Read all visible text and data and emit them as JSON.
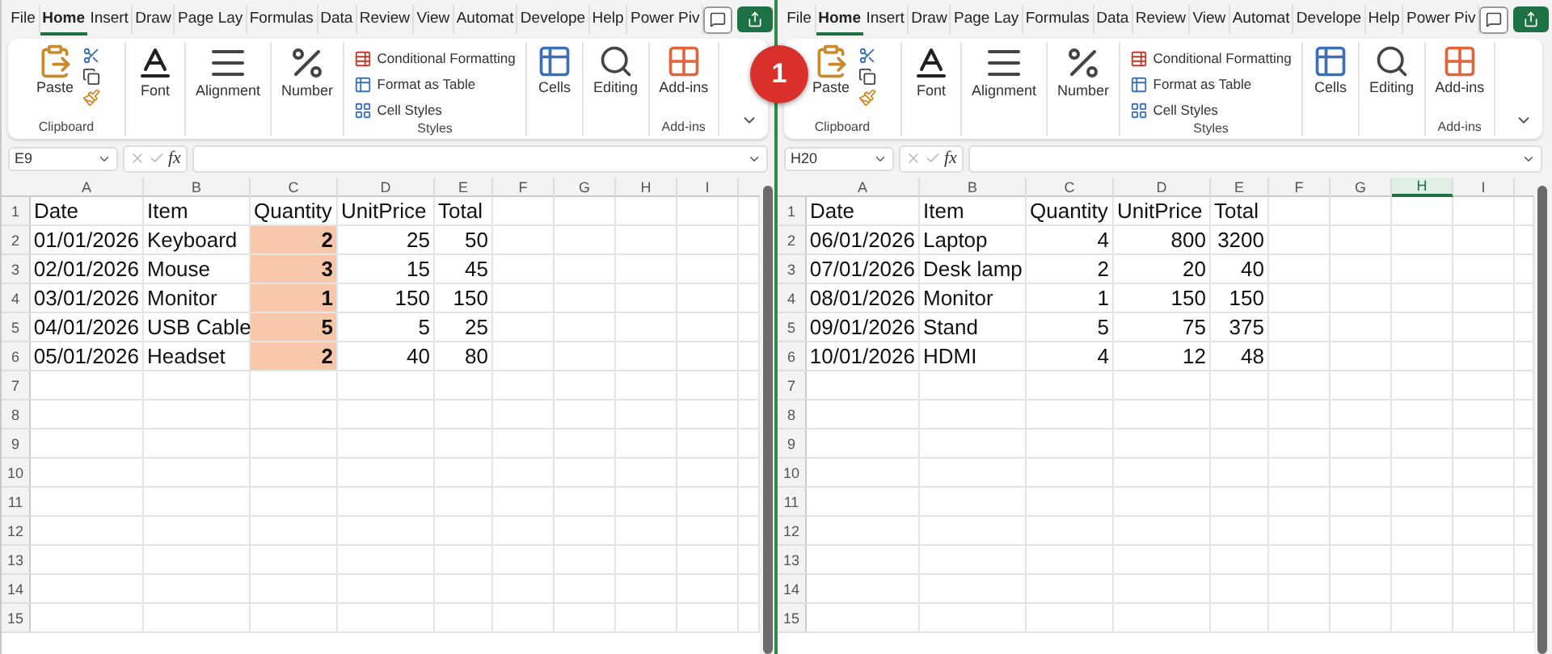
{
  "windows": [
    {
      "tabs": [
        {
          "label": "File",
          "selected": false
        },
        {
          "label": "Home",
          "selected": true
        },
        {
          "label": "Insert",
          "selected": false
        },
        {
          "label": "Draw",
          "selected": false
        },
        {
          "label": "Page Lay",
          "selected": false
        },
        {
          "label": "Formulas",
          "selected": false
        },
        {
          "label": "Data",
          "selected": false
        },
        {
          "label": "Review",
          "selected": false
        },
        {
          "label": "View",
          "selected": false
        },
        {
          "label": "Automat",
          "selected": false
        },
        {
          "label": "Develope",
          "selected": false
        },
        {
          "label": "Help",
          "selected": false
        },
        {
          "label": "Power Piv",
          "selected": false
        }
      ],
      "ribbon": [
        {
          "kind": "clipboard",
          "label": "Paste",
          "group": "Clipboard"
        },
        {
          "kind": "font",
          "label": "Font"
        },
        {
          "kind": "alignment",
          "label": "Alignment"
        },
        {
          "kind": "number",
          "label": "Number"
        },
        {
          "kind": "styles",
          "items": [
            "Conditional Formatting",
            "Format as Table",
            "Cell Styles"
          ],
          "group": "Styles"
        },
        {
          "kind": "cells",
          "label": "Cells"
        },
        {
          "kind": "editing",
          "label": "Editing"
        },
        {
          "kind": "addins",
          "label": "Add-ins",
          "group": "Add-ins"
        }
      ],
      "name_box": "E9",
      "fx": "fx",
      "columns": [
        {
          "label": "A",
          "selected": false
        },
        {
          "label": "B",
          "selected": false
        },
        {
          "label": "C",
          "selected": false
        },
        {
          "label": "D",
          "selected": false
        },
        {
          "label": "E",
          "selected": false
        },
        {
          "label": "F",
          "selected": false
        },
        {
          "label": "G",
          "selected": false
        },
        {
          "label": "H",
          "selected": false
        },
        {
          "label": "I",
          "selected": false
        }
      ],
      "rows": [
        {
          "header": "1",
          "cells": [
            {
              "text": "Date",
              "kind": "text",
              "highlight": false,
              "bold": false
            },
            {
              "text": "Item",
              "kind": "text",
              "highlight": false,
              "bold": false
            },
            {
              "text": "Quantity",
              "kind": "text",
              "highlight": false,
              "bold": false
            },
            {
              "text": "UnitPrice",
              "kind": "text",
              "highlight": false,
              "bold": false
            },
            {
              "text": "Total",
              "kind": "text",
              "highlight": false,
              "bold": false
            }
          ]
        },
        {
          "header": "2",
          "cells": [
            {
              "text": "01/01/2026",
              "kind": "number",
              "highlight": false,
              "bold": false
            },
            {
              "text": "Keyboard",
              "kind": "text",
              "highlight": false,
              "bold": false
            },
            {
              "text": "2",
              "kind": "number",
              "highlight": true,
              "bold": true
            },
            {
              "text": "25",
              "kind": "number",
              "highlight": false,
              "bold": false
            },
            {
              "text": "50",
              "kind": "number",
              "highlight": false,
              "bold": false
            }
          ]
        },
        {
          "header": "3",
          "cells": [
            {
              "text": "02/01/2026",
              "kind": "number",
              "highlight": false,
              "bold": false
            },
            {
              "text": "Mouse",
              "kind": "text",
              "highlight": false,
              "bold": false
            },
            {
              "text": "3",
              "kind": "number",
              "highlight": true,
              "bold": true
            },
            {
              "text": "15",
              "kind": "number",
              "highlight": false,
              "bold": false
            },
            {
              "text": "45",
              "kind": "number",
              "highlight": false,
              "bold": false
            }
          ]
        },
        {
          "header": "4",
          "cells": [
            {
              "text": "03/01/2026",
              "kind": "number",
              "highlight": false,
              "bold": false
            },
            {
              "text": "Monitor",
              "kind": "text",
              "highlight": false,
              "bold": false
            },
            {
              "text": "1",
              "kind": "number",
              "highlight": true,
              "bold": true
            },
            {
              "text": "150",
              "kind": "number",
              "highlight": false,
              "bold": false
            },
            {
              "text": "150",
              "kind": "number",
              "highlight": false,
              "bold": false
            }
          ]
        },
        {
          "header": "5",
          "cells": [
            {
              "text": "04/01/2026",
              "kind": "number",
              "highlight": false,
              "bold": false
            },
            {
              "text": "USB Cable",
              "kind": "text",
              "highlight": false,
              "bold": false
            },
            {
              "text": "5",
              "kind": "number",
              "highlight": true,
              "bold": true
            },
            {
              "text": "5",
              "kind": "number",
              "highlight": false,
              "bold": false
            },
            {
              "text": "25",
              "kind": "number",
              "highlight": false,
              "bold": false
            }
          ]
        },
        {
          "header": "6",
          "cells": [
            {
              "text": "05/01/2026",
              "kind": "number",
              "highlight": false,
              "bold": false
            },
            {
              "text": "Headset",
              "kind": "text",
              "highlight": false,
              "bold": false
            },
            {
              "text": "2",
              "kind": "number",
              "highlight": true,
              "bold": true
            },
            {
              "text": "40",
              "kind": "number",
              "highlight": false,
              "bold": false
            },
            {
              "text": "80",
              "kind": "number",
              "highlight": false,
              "bold": false
            }
          ]
        },
        {
          "header": "7",
          "cells": []
        },
        {
          "header": "8",
          "cells": []
        },
        {
          "header": "9",
          "cells": []
        },
        {
          "header": "10",
          "cells": []
        },
        {
          "header": "11",
          "cells": []
        },
        {
          "header": "12",
          "cells": []
        },
        {
          "header": "13",
          "cells": []
        },
        {
          "header": "14",
          "cells": []
        },
        {
          "header": "15",
          "cells": []
        }
      ]
    },
    {
      "tabs": [
        {
          "label": "File",
          "selected": false
        },
        {
          "label": "Home",
          "selected": true
        },
        {
          "label": "Insert",
          "selected": false
        },
        {
          "label": "Draw",
          "selected": false
        },
        {
          "label": "Page Lay",
          "selected": false
        },
        {
          "label": "Formulas",
          "selected": false
        },
        {
          "label": "Data",
          "selected": false
        },
        {
          "label": "Review",
          "selected": false
        },
        {
          "label": "View",
          "selected": false
        },
        {
          "label": "Automat",
          "selected": false
        },
        {
          "label": "Develope",
          "selected": false
        },
        {
          "label": "Help",
          "selected": false
        },
        {
          "label": "Power Piv",
          "selected": false
        }
      ],
      "ribbon": [
        {
          "kind": "clipboard",
          "label": "Paste",
          "group": "Clipboard"
        },
        {
          "kind": "font",
          "label": "Font"
        },
        {
          "kind": "alignment",
          "label": "Alignment"
        },
        {
          "kind": "number",
          "label": "Number"
        },
        {
          "kind": "styles",
          "items": [
            "Conditional Formatting",
            "Format as Table",
            "Cell Styles"
          ],
          "group": "Styles"
        },
        {
          "kind": "cells",
          "label": "Cells"
        },
        {
          "kind": "editing",
          "label": "Editing"
        },
        {
          "kind": "addins",
          "label": "Add-ins",
          "group": "Add-ins"
        }
      ],
      "name_box": "H20",
      "fx": "fx",
      "columns": [
        {
          "label": "A",
          "selected": false
        },
        {
          "label": "B",
          "selected": false
        },
        {
          "label": "C",
          "selected": false
        },
        {
          "label": "D",
          "selected": false
        },
        {
          "label": "E",
          "selected": false
        },
        {
          "label": "F",
          "selected": false
        },
        {
          "label": "G",
          "selected": false
        },
        {
          "label": "H",
          "selected": true
        },
        {
          "label": "I",
          "selected": false
        }
      ],
      "rows": [
        {
          "header": "1",
          "cells": [
            {
              "text": "Date",
              "kind": "text",
              "highlight": false,
              "bold": false
            },
            {
              "text": "Item",
              "kind": "text",
              "highlight": false,
              "bold": false
            },
            {
              "text": "Quantity",
              "kind": "text",
              "highlight": false,
              "bold": false
            },
            {
              "text": "UnitPrice",
              "kind": "text",
              "highlight": false,
              "bold": false
            },
            {
              "text": "Total",
              "kind": "text",
              "highlight": false,
              "bold": false
            }
          ]
        },
        {
          "header": "2",
          "cells": [
            {
              "text": "06/01/2026",
              "kind": "number",
              "highlight": false,
              "bold": false
            },
            {
              "text": "Laptop",
              "kind": "text",
              "highlight": false,
              "bold": false
            },
            {
              "text": "4",
              "kind": "number",
              "highlight": false,
              "bold": false
            },
            {
              "text": "800",
              "kind": "number",
              "highlight": false,
              "bold": false
            },
            {
              "text": "3200",
              "kind": "number",
              "highlight": false,
              "bold": false
            }
          ]
        },
        {
          "header": "3",
          "cells": [
            {
              "text": "07/01/2026",
              "kind": "number",
              "highlight": false,
              "bold": false
            },
            {
              "text": "Desk lamp",
              "kind": "text",
              "highlight": false,
              "bold": false
            },
            {
              "text": "2",
              "kind": "number",
              "highlight": false,
              "bold": false
            },
            {
              "text": "20",
              "kind": "number",
              "highlight": false,
              "bold": false
            },
            {
              "text": "40",
              "kind": "number",
              "highlight": false,
              "bold": false
            }
          ]
        },
        {
          "header": "4",
          "cells": [
            {
              "text": "08/01/2026",
              "kind": "number",
              "highlight": false,
              "bold": false
            },
            {
              "text": "Monitor",
              "kind": "text",
              "highlight": false,
              "bold": false
            },
            {
              "text": "1",
              "kind": "number",
              "highlight": false,
              "bold": false
            },
            {
              "text": "150",
              "kind": "number",
              "highlight": false,
              "bold": false
            },
            {
              "text": "150",
              "kind": "number",
              "highlight": false,
              "bold": false
            }
          ]
        },
        {
          "header": "5",
          "cells": [
            {
              "text": "09/01/2026",
              "kind": "number",
              "highlight": false,
              "bold": false
            },
            {
              "text": "Stand",
              "kind": "text",
              "highlight": false,
              "bold": false
            },
            {
              "text": "5",
              "kind": "number",
              "highlight": false,
              "bold": false
            },
            {
              "text": "75",
              "kind": "number",
              "highlight": false,
              "bold": false
            },
            {
              "text": "375",
              "kind": "number",
              "highlight": false,
              "bold": false
            }
          ]
        },
        {
          "header": "6",
          "cells": [
            {
              "text": "10/01/2026",
              "kind": "number",
              "highlight": false,
              "bold": false
            },
            {
              "text": "HDMI",
              "kind": "text",
              "highlight": false,
              "bold": false
            },
            {
              "text": "4",
              "kind": "number",
              "highlight": false,
              "bold": false
            },
            {
              "text": "12",
              "kind": "number",
              "highlight": false,
              "bold": false
            },
            {
              "text": "48",
              "kind": "number",
              "highlight": false,
              "bold": false
            }
          ]
        },
        {
          "header": "7",
          "cells": []
        },
        {
          "header": "8",
          "cells": []
        },
        {
          "header": "9",
          "cells": []
        },
        {
          "header": "10",
          "cells": []
        },
        {
          "header": "11",
          "cells": []
        },
        {
          "header": "12",
          "cells": []
        },
        {
          "header": "13",
          "cells": []
        },
        {
          "header": "14",
          "cells": []
        },
        {
          "header": "15",
          "cells": []
        }
      ]
    }
  ],
  "badge": "1"
}
